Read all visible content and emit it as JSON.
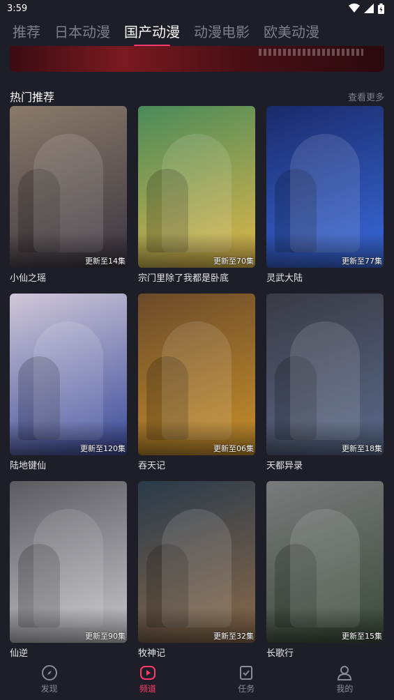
{
  "status": {
    "time": "3:59"
  },
  "tabs": [
    {
      "label": "推荐"
    },
    {
      "label": "日本动漫"
    },
    {
      "label": "国产动漫"
    },
    {
      "label": "动漫电影"
    },
    {
      "label": "欧美动漫"
    }
  ],
  "active_tab": 2,
  "section": {
    "title": "热门推荐",
    "more": "查看更多"
  },
  "cards": [
    {
      "title": "小仙之瑶",
      "episode": "更新至14集",
      "colors": [
        "#8a7a6a",
        "#3a3540"
      ]
    },
    {
      "title": "宗门里除了我都是卧底",
      "episode": "更新至70集",
      "colors": [
        "#4a8a5a",
        "#e0b84a"
      ]
    },
    {
      "title": "灵武大陆",
      "episode": "更新至77集",
      "colors": [
        "#1a2a6a",
        "#3a6adc"
      ]
    },
    {
      "title": "陆地键仙",
      "episode": "更新至120集",
      "colors": [
        "#d0c8d8",
        "#3a4a9a"
      ]
    },
    {
      "title": "吞天记",
      "episode": "更新至06集",
      "colors": [
        "#6a4a2a",
        "#c8902a"
      ]
    },
    {
      "title": "天都异录",
      "episode": "更新至18集",
      "colors": [
        "#3a3a44",
        "#5a6a8a"
      ]
    },
    {
      "title": "仙逆",
      "episode": "更新至90集",
      "colors": [
        "#5a5a60",
        "#c8c8cc"
      ]
    },
    {
      "title": "牧神记",
      "episode": "更新至32集",
      "colors": [
        "#2a3a4a",
        "#8a6a4a"
      ]
    },
    {
      "title": "长歌行",
      "episode": "更新至15集",
      "colors": [
        "#7a7a7c",
        "#3a4a3a"
      ]
    }
  ],
  "nav": [
    {
      "label": "发现",
      "icon": "compass-icon"
    },
    {
      "label": "频道",
      "icon": "play-icon"
    },
    {
      "label": "任务",
      "icon": "task-icon"
    },
    {
      "label": "我的",
      "icon": "user-icon"
    }
  ],
  "active_nav": 1,
  "colors": {
    "accent": "#ff3b6b",
    "background": "#1d1e27",
    "inactive": "#7d7f8c"
  }
}
